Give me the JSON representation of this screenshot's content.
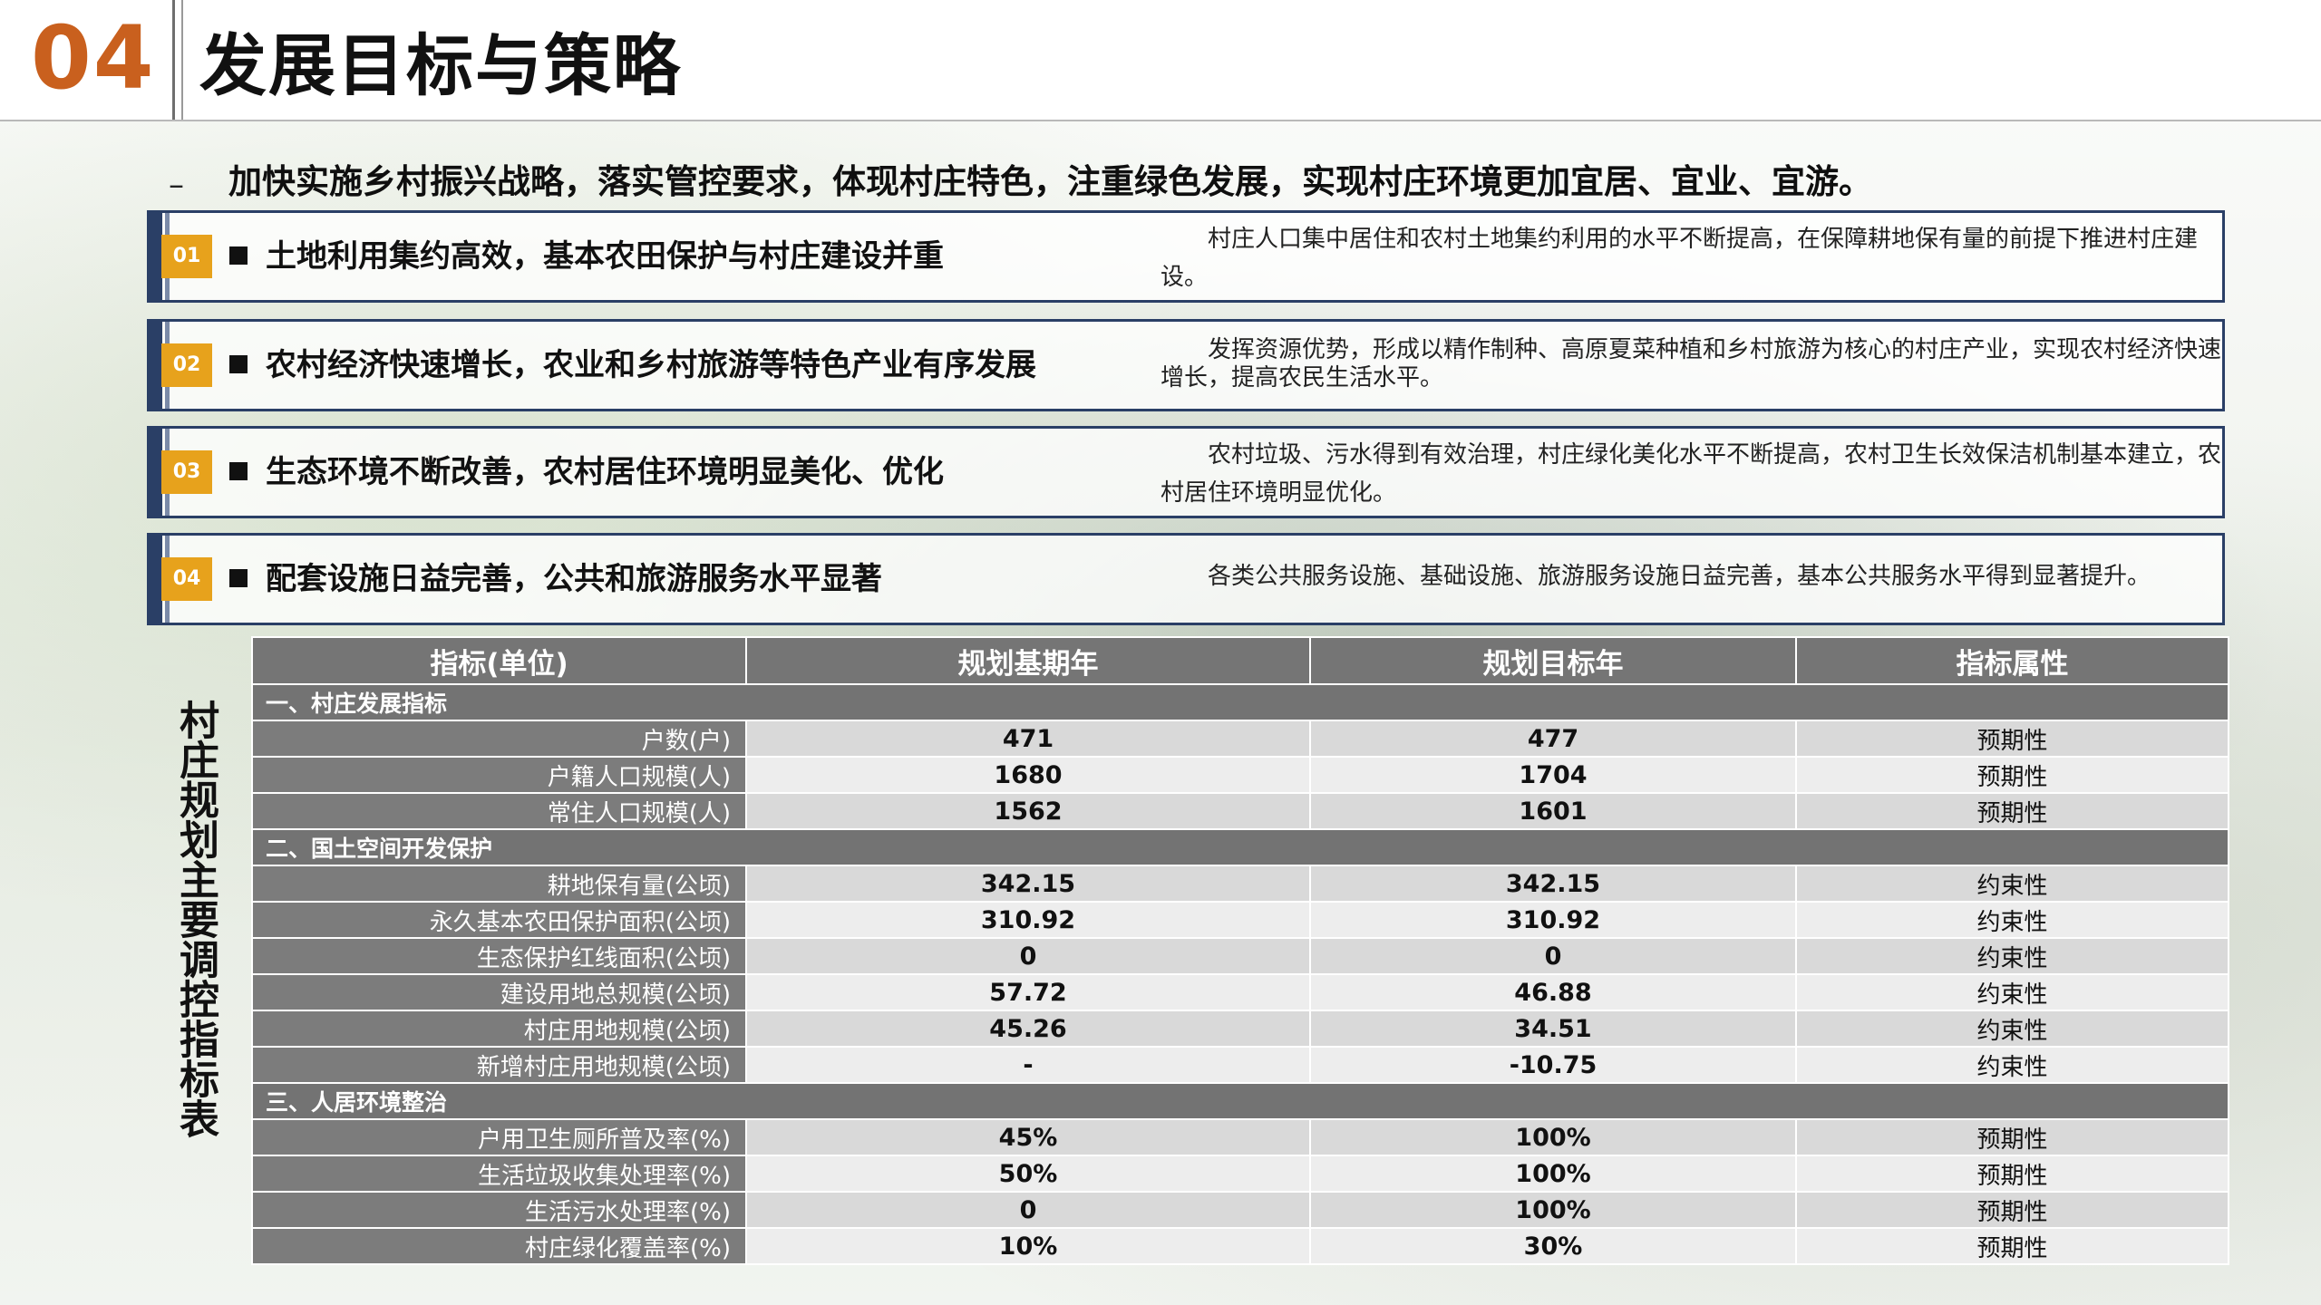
{
  "header": {
    "section_number": "04",
    "title": "发展目标与策略"
  },
  "intro": {
    "dash": "–",
    "text": "加快实施乡村振兴战略，落实管控要求，体现村庄特色，注重绿色发展，实现村庄环境更加宜居、宜业、宜游。"
  },
  "goals": [
    {
      "badge": "01",
      "title": "土地利用集约高效，基本农田保护与村庄建设并重",
      "desc": "村庄人口集中居住和农村土地集约利用的水平不断提高，在保障耕地保有量的前提下推进村庄建设。"
    },
    {
      "badge": "02",
      "title": "农村经济快速增长，农业和乡村旅游等特色产业有序发展",
      "desc": "发挥资源优势，形成以精作制种、高原夏菜种植和乡村旅游为核心的村庄产业，实现农村经济快速增长，提高农民生活水平。"
    },
    {
      "badge": "03",
      "title": "生态环境不断改善，农村居住环境明显美化、优化",
      "desc": "农村垃圾、污水得到有效治理，村庄绿化美化水平不断提高，农村卫生长效保洁机制基本建立，农村居住环境明显优化。"
    },
    {
      "badge": "04",
      "title": "配套设施日益完善，公共和旅游服务水平显著",
      "desc": "各类公共服务设施、基础设施、旅游服务设施日益完善，基本公共服务水平得到显著提升。"
    }
  ],
  "table_label": "村庄规划主要调控指标表",
  "table": {
    "headers": [
      "指标(单位)",
      "规划基期年",
      "规划目标年",
      "指标属性"
    ],
    "sections": [
      {
        "title": "一、村庄发展指标",
        "rows": [
          {
            "name": "户数(户)",
            "base": "471",
            "target": "477",
            "attr": "预期性"
          },
          {
            "name": "户籍人口规模(人)",
            "base": "1680",
            "target": "1704",
            "attr": "预期性"
          },
          {
            "name": "常住人口规模(人)",
            "base": "1562",
            "target": "1601",
            "attr": "预期性"
          }
        ]
      },
      {
        "title": "二、国土空间开发保护",
        "rows": [
          {
            "name": "耕地保有量(公顷)",
            "base": "342.15",
            "target": "342.15",
            "attr": "约束性"
          },
          {
            "name": "永久基本农田保护面积(公顷)",
            "base": "310.92",
            "target": "310.92",
            "attr": "约束性"
          },
          {
            "name": "生态保护红线面积(公顷)",
            "base": "0",
            "target": "0",
            "attr": "约束性"
          },
          {
            "name": "建设用地总规模(公顷)",
            "base": "57.72",
            "target": "46.88",
            "attr": "约束性"
          },
          {
            "name": "村庄用地规模(公顷)",
            "base": "45.26",
            "target": "34.51",
            "attr": "约束性"
          },
          {
            "name": "新增村庄用地规模(公顷)",
            "base": "-",
            "target": "-10.75",
            "attr": "约束性"
          }
        ]
      },
      {
        "title": "三、人居环境整治",
        "rows": [
          {
            "name": "户用卫生厕所普及率(%)",
            "base": "45%",
            "target": "100%",
            "attr": "预期性"
          },
          {
            "name": "生活垃圾收集处理率(%)",
            "base": "50%",
            "target": "100%",
            "attr": "预期性"
          },
          {
            "name": "生活污水处理率(%)",
            "base": "0",
            "target": "100%",
            "attr": "预期性"
          },
          {
            "name": "村庄绿化覆盖率(%)",
            "base": "10%",
            "target": "30%",
            "attr": "预期性"
          }
        ]
      }
    ]
  },
  "colors": {
    "accent_orange": "#c9601e",
    "badge_yellow": "#e7a21c",
    "box_border_navy": "#2a3f66",
    "table_header_gray": "#757575"
  }
}
